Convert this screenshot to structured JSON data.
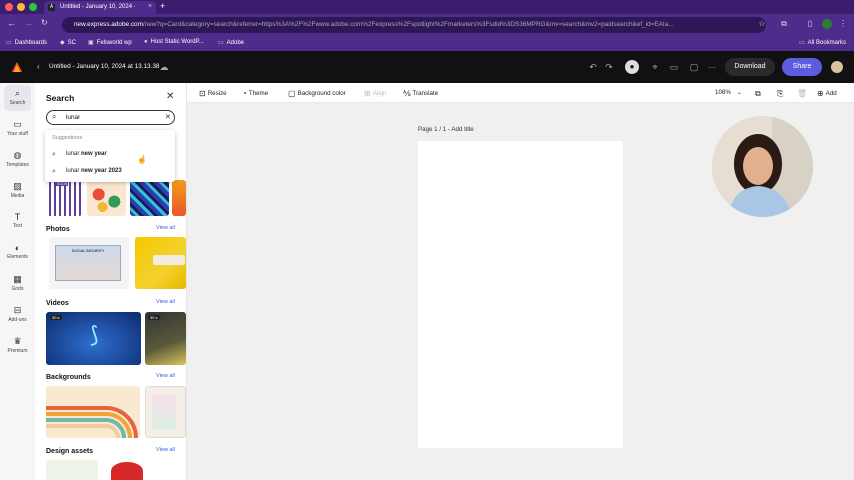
{
  "browser": {
    "tab_title": "Untitled - January 10, 2024 ·",
    "tab_icon": "Adobe",
    "url_host": "new.express.adobe.com",
    "url_rest": "/new?q=Card&category=search&referrer=https%3A%2F%2Fwww.adobe.com%2Fexpress%2Fspotlight%2Fmarketers%3Fsdid%3DS36MPRG&mv=search&mv2=paidsearch&ef_id=EAIa...",
    "bookmarks": [
      "Dashboards",
      "SC",
      "Felsworld wp",
      "Host Static WordP...",
      "Adobe"
    ],
    "all_bookmarks": "All Bookmarks"
  },
  "app": {
    "doc_title": "Untitled - January 10, 2024 at 13.13.38",
    "download_label": "Download",
    "share_label": "Share"
  },
  "rail": [
    {
      "label": "Search",
      "icon": "search-icon"
    },
    {
      "label": "Your stuff",
      "icon": "folder-icon"
    },
    {
      "label": "Templates",
      "icon": "templates-icon"
    },
    {
      "label": "Media",
      "icon": "media-icon"
    },
    {
      "label": "Text",
      "icon": "text-icon"
    },
    {
      "label": "Elements",
      "icon": "elements-icon"
    },
    {
      "label": "Grids",
      "icon": "grids-icon"
    },
    {
      "label": "Add-ons",
      "icon": "addons-icon"
    },
    {
      "label": "Premium",
      "icon": "crown-icon"
    }
  ],
  "panel": {
    "title": "Search",
    "search_value": "lunar",
    "suggestions_label": "Suggestions",
    "suggestions": [
      {
        "prefix": "lunar",
        "rest": " new year"
      },
      {
        "prefix": "lunar",
        "rest": " new year 2023"
      }
    ],
    "sections": [
      {
        "title": "Photos",
        "view_all": "View all"
      },
      {
        "title": "Videos",
        "view_all": "View all"
      },
      {
        "title": "Backgrounds",
        "view_all": "View all"
      },
      {
        "title": "Design assets",
        "view_all": "View all"
      }
    ],
    "video_badge_1": "30 s",
    "video_badge_2": "30 s",
    "template_badge": "SOON",
    "social_security": "SOCIAL SECURITY"
  },
  "toolbar": {
    "resize": "Resize",
    "theme": "Theme",
    "background": "Background color",
    "align": "Align",
    "translate": "Translate",
    "zoom": "108%",
    "add": "Add"
  },
  "canvas": {
    "page_label": "Page 1 / 1 - Add title"
  },
  "colors": {
    "brand_accent": "#5c5ce0",
    "browser_frame": "#4e2c8c",
    "link_blue": "#3a57e0"
  }
}
